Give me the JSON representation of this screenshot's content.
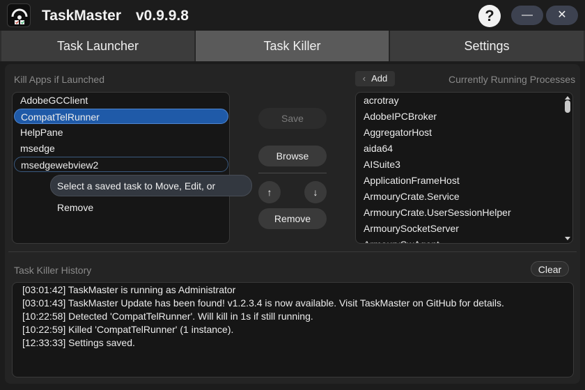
{
  "app": {
    "title": "TaskMaster",
    "version": "v0.9.9.8",
    "help_glyph": "?",
    "minimize_glyph": "—",
    "close_glyph": "✕",
    "icon": "tool-icon"
  },
  "tabs": [
    {
      "label": "Task Launcher",
      "active": false
    },
    {
      "label": "Task Killer",
      "active": true
    },
    {
      "label": "Settings",
      "active": false
    }
  ],
  "kill_list": {
    "label": "Kill Apps if Launched",
    "items": [
      "AdobeGCClient",
      "CompatTelRunner",
      "HelpPane",
      "msedge",
      "msedgewebview2"
    ],
    "selected_index": 1
  },
  "tooltip": "Select a saved task to Move, Edit, or Remove",
  "buttons": {
    "save": "Save",
    "browse": "Browse",
    "move_up": "↑",
    "move_down": "↓",
    "remove": "Remove",
    "add_arrow": "‹",
    "add": "Add",
    "clear": "Clear"
  },
  "processes": {
    "label": "Currently Running Processes",
    "items": [
      "acrotray",
      "AdobeIPCBroker",
      "AggregatorHost",
      "aida64",
      "AISuite3",
      "ApplicationFrameHost",
      "ArmouryCrate.Service",
      "ArmouryCrate.UserSessionHelper",
      "ArmourySocketServer",
      "ArmourySwAgent"
    ]
  },
  "history": {
    "label": "Task Killer History",
    "lines": [
      "[03:01:42]  TaskMaster is running as Administrator",
      "[03:01:43]  TaskMaster Update has been found! v1.2.3.4 is now available. Visit TaskMaster on GitHub for details.",
      "[10:22:58]  Detected 'CompatTelRunner'. Will kill in 1s if still running.",
      "[10:22:59]  Killed 'CompatTelRunner' (1 instance).",
      "[12:33:33]  Settings saved."
    ]
  },
  "colors": {
    "accent": "#1f5aa8",
    "background": "#1c1c1c",
    "panel": "#242424",
    "tab_active": "#5a5a5a"
  }
}
